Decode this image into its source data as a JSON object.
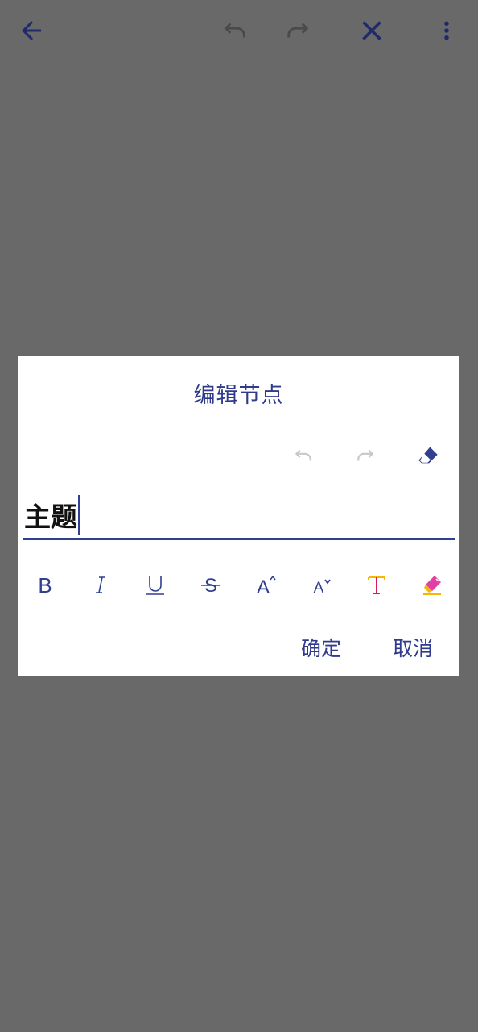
{
  "toolbar": {
    "back_icon": "arrow-left-icon",
    "undo_icon": "undo-icon",
    "redo_icon": "redo-icon",
    "close_icon": "close-icon",
    "more_icon": "more-vertical-icon"
  },
  "dialog": {
    "title": "编辑节点",
    "input_value": "主题",
    "undo_icon": "undo-icon",
    "redo_icon": "redo-icon",
    "clear_icon": "eraser-icon",
    "format_buttons": [
      {
        "name": "bold",
        "label": "B"
      },
      {
        "name": "italic",
        "label": "I"
      },
      {
        "name": "underline",
        "label": "U"
      },
      {
        "name": "strikethrough",
        "label": "S"
      },
      {
        "name": "increase-font-size",
        "label": "A"
      },
      {
        "name": "decrease-font-size",
        "label": "A"
      },
      {
        "name": "text-color",
        "label": "T"
      },
      {
        "name": "highlight",
        "label": ""
      }
    ],
    "confirm_label": "确定",
    "cancel_label": "取消"
  },
  "colors": {
    "accent": "#303a8c",
    "overlay": "#696969",
    "disabled": "#c8c8c8",
    "text_color_icon": "#d81b60",
    "highlight_icon": "#f5b800"
  }
}
